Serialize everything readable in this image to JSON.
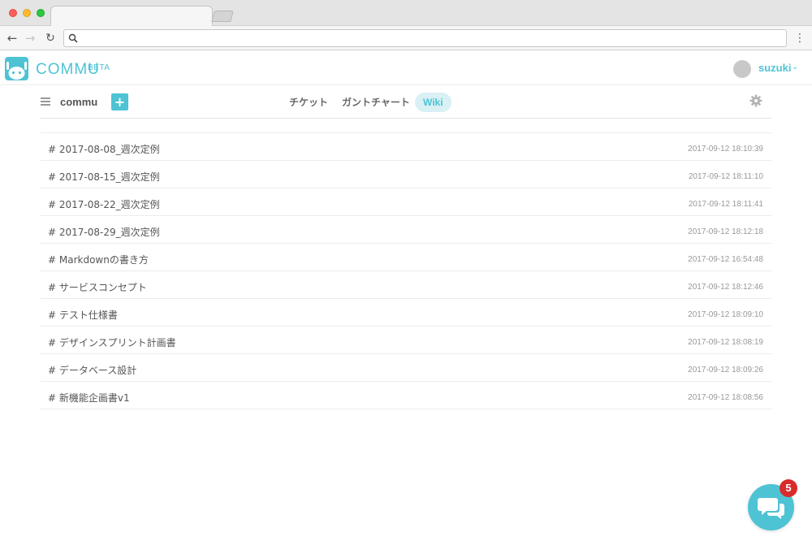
{
  "app": {
    "name": "COMMU",
    "badge": "BETA",
    "brand_color": "#4ec3d4"
  },
  "user": {
    "name": "suzuki",
    "chevron": "⌄"
  },
  "browser": {
    "back_glyph": "←",
    "forward_glyph": "→",
    "reload_glyph": "↻",
    "menu_glyph": "⋮",
    "url": ""
  },
  "project": {
    "name": "commu",
    "add_label": "+",
    "tabs": [
      {
        "label": "チケット",
        "active": false
      },
      {
        "label": "ガントチャート",
        "active": false
      },
      {
        "label": "Wiki",
        "active": true
      }
    ]
  },
  "wiki": {
    "pages": [
      {
        "title": "# 2017-08-08_週次定例",
        "updated": "2017-09-12 18:10:39"
      },
      {
        "title": "# 2017-08-15_週次定例",
        "updated": "2017-09-12 18:11:10"
      },
      {
        "title": "# 2017-08-22_週次定例",
        "updated": "2017-09-12 18:11:41"
      },
      {
        "title": "# 2017-08-29_週次定例",
        "updated": "2017-09-12 18:12:18"
      },
      {
        "title": "# Markdownの書き方",
        "updated": "2017-09-12 16:54:48"
      },
      {
        "title": "# サービスコンセプト",
        "updated": "2017-09-12 18:12:46"
      },
      {
        "title": "# テスト仕様書",
        "updated": "2017-09-12 18:09:10"
      },
      {
        "title": "# デザインスプリント計画書",
        "updated": "2017-09-12 18:08:19"
      },
      {
        "title": "# データベース設計",
        "updated": "2017-09-12 18:09:26"
      },
      {
        "title": "# 新機能企画書v1",
        "updated": "2017-09-12 18:08:56"
      }
    ]
  },
  "chat": {
    "unread_count": "5",
    "badge_color": "#d92b2b"
  }
}
